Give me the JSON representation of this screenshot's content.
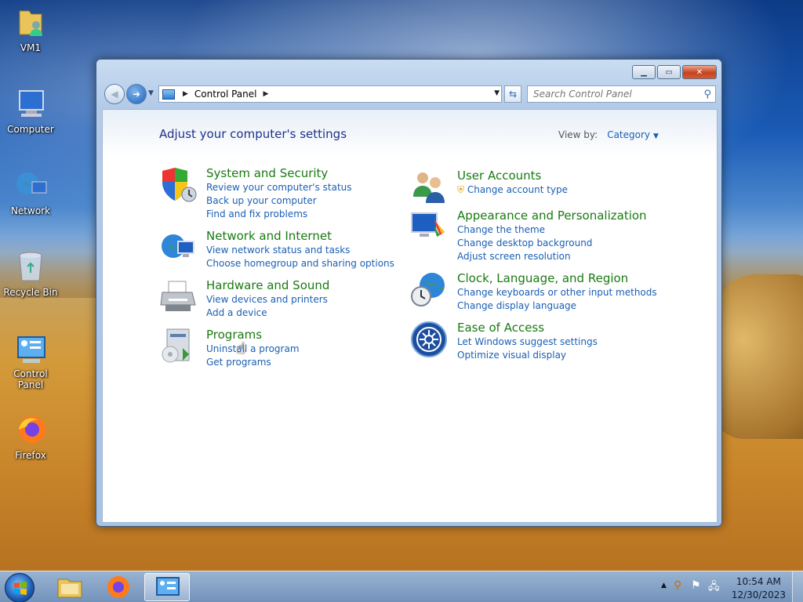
{
  "desktop": {
    "icons": [
      {
        "label": "VM1",
        "icon": "user-folder-icon"
      },
      {
        "label": "Computer",
        "icon": "computer-icon"
      },
      {
        "label": "Network",
        "icon": "network-icon"
      },
      {
        "label": "Recycle Bin",
        "icon": "recycle-bin-icon"
      },
      {
        "label": "Control Panel",
        "icon": "control-panel-icon"
      },
      {
        "label": "Firefox",
        "icon": "firefox-icon"
      }
    ]
  },
  "window": {
    "controls": {
      "minimize": "▁",
      "maximize": "▭",
      "close": "✕"
    },
    "address": {
      "segment": "Control Panel"
    },
    "search": {
      "placeholder": "Search Control Panel"
    },
    "heading": "Adjust your computer's settings",
    "view_by": {
      "label": "View by:",
      "value": "Category"
    },
    "categories_left": [
      {
        "title": "System and Security",
        "icon": "shield-icon",
        "links": [
          "Review your computer's status",
          "Back up your computer",
          "Find and fix problems"
        ]
      },
      {
        "title": "Network and Internet",
        "icon": "globe-network-icon",
        "links": [
          "View network status and tasks",
          "Choose homegroup and sharing options"
        ]
      },
      {
        "title": "Hardware and Sound",
        "icon": "printer-icon",
        "links": [
          "View devices and printers",
          "Add a device"
        ]
      },
      {
        "title": "Programs",
        "icon": "programs-icon",
        "links": [
          "Uninstall a program",
          "Get programs"
        ]
      }
    ],
    "categories_right": [
      {
        "title": "User Accounts",
        "icon": "users-icon",
        "links": [
          "Change account type"
        ]
      },
      {
        "title": "Appearance and Personalization",
        "icon": "monitor-paint-icon",
        "links": [
          "Change the theme",
          "Change desktop background",
          "Adjust screen resolution"
        ]
      },
      {
        "title": "Clock, Language, and Region",
        "icon": "clock-globe-icon",
        "links": [
          "Change keyboards or other input methods",
          "Change display language"
        ]
      },
      {
        "title": "Ease of Access",
        "icon": "ease-of-access-icon",
        "links": [
          "Let Windows suggest settings",
          "Optimize visual display"
        ]
      }
    ]
  },
  "taskbar": {
    "clock": {
      "time": "10:54 AM",
      "date": "12/30/2023"
    }
  },
  "colors": {
    "category_title": "#1a7a12",
    "link": "#1a5fb4",
    "heading": "#1e3287"
  }
}
